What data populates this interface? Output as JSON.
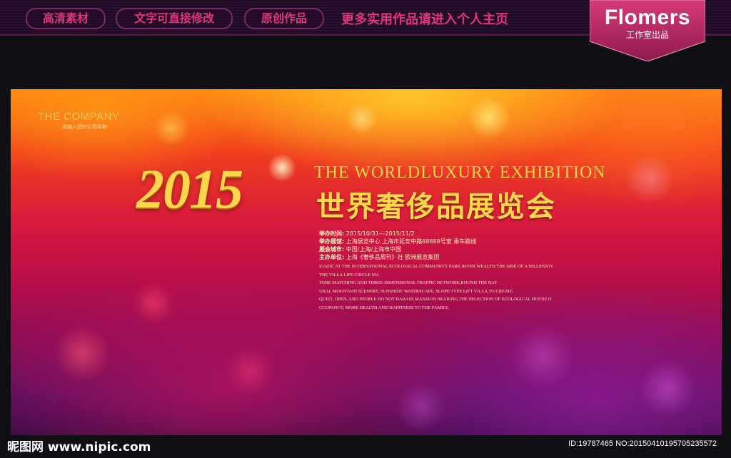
{
  "topbar": {
    "tags": [
      "高清素材",
      "文字可直接修改",
      "原创作品"
    ],
    "promo": "更多实用作品请进入个人主页",
    "badge_title": "Flomers",
    "badge_sub": "工作室出品"
  },
  "poster": {
    "company": "THE COMPANY",
    "company_sub": "请输入您的公司名称",
    "year": "2015",
    "en_title": "THE WORLDLUXURY EXHIBITION",
    "cn_title": "世界奢侈品展览会",
    "info": [
      {
        "key": "举办时间:",
        "value": "2015/10/31---2015/11/2"
      },
      {
        "key": "举办展馆:",
        "value": "上海展览中心 上海市延安中路88888号室  乘车路线"
      },
      {
        "key": "展会城市:",
        "value": "中国/上海/上海市中国"
      },
      {
        "key": "主办单位:",
        "value": "上海《奢侈品周刊》社 欧洲展览集团"
      }
    ],
    "description": [
      "STATIC AT THE INTERNATIONAL ECOLOGICAL COMMUNITY PARK RIVER WEALTH THE SIDE OF A HILLENJOY",
      "THE VILLA LIFE CIRCLE MA",
      "TURE MATCHING AND THREE-DIMENSIONAL TRAFFIC NETWORK,ROUND THE NAT",
      "URAL MOUNTAIN SCENERY, SUNSHINE WATERSCAPE, SLOPE TYPE LIFT VILLA,TO CREATE",
      "QUIET, OPEN, AND PEOPLE DO NOT HARASS MANSION BEARING,THE SELECTION OF ECOLOGICAL HOUSE O",
      "CCUPANCY, MORE HEALTH AND HAPPINESS TO THE FAMILY."
    ]
  },
  "watermark": {
    "left": "昵图网 www.nipic.com",
    "right": "ID:19787465 NO:20150410195705235572"
  },
  "colors": {
    "accent_pink": "#e0357a",
    "gold": "#ffd54a",
    "badge_bg": "#c0306a"
  }
}
